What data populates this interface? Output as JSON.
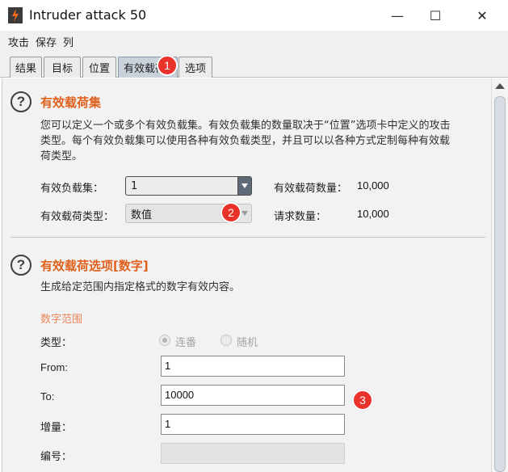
{
  "window": {
    "title": "Intruder attack 50",
    "controls": {
      "minimize": "—",
      "maximize": "☐",
      "close": "✕"
    }
  },
  "menu": [
    "攻击",
    "保存",
    "列"
  ],
  "tabs": [
    {
      "label": "结果",
      "active": false
    },
    {
      "label": "目标",
      "active": false
    },
    {
      "label": "位置",
      "active": false
    },
    {
      "label": "有效载荷",
      "active": true
    },
    {
      "label": "选项",
      "active": false
    }
  ],
  "badges": [
    "1",
    "2",
    "3"
  ],
  "payload_sets": {
    "help_icon": "?",
    "title": "有效载荷集",
    "description_line1": "您可以定义一个或多个有效负载集。有效负载集的数量取决于“位置”选项卡中定义的攻击",
    "description_line2": "类型。每个有效负载集可以使用各种有效负载类型，并且可以以各种方式定制每种有效载",
    "description_line3": "荷类型。",
    "set_label": "有效负载集：",
    "set_value": "1",
    "type_label": "有效载荷类型：",
    "type_value": "数值",
    "count_label": "有效载荷数量：",
    "count_value": "10,000",
    "request_label": "请求数量：",
    "request_value": "10,000"
  },
  "payload_options": {
    "help_icon": "?",
    "title": "有效载荷选项[数字]",
    "description": "生成给定范围内指定格式的数字有效内容。",
    "range_heading": "数字范围",
    "type_label": "类型：",
    "radio_sequential": "连番",
    "radio_random": "随机",
    "selected_radio": "连番",
    "from_label": "From:",
    "from_value": "1",
    "to_label": "To:",
    "to_value": "10000",
    "step_label": "增量：",
    "step_value": "1",
    "number_label": "编号：",
    "number_value": ""
  },
  "colors": {
    "section_title": "#e0601d",
    "subheading": "#e88658",
    "badge": "#e8322a",
    "active_tab": "#c9d2db"
  }
}
